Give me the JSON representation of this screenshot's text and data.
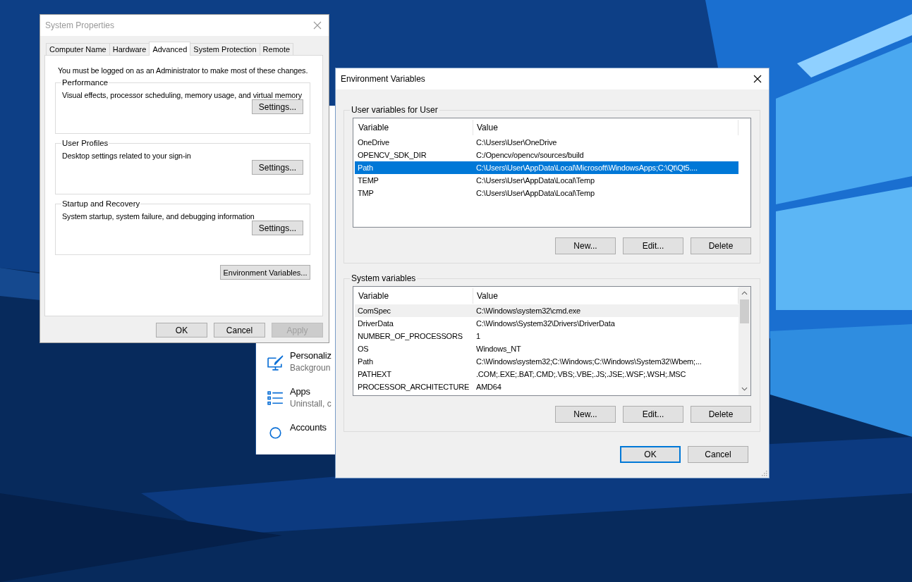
{
  "settings_window": {
    "items": [
      {
        "kind": "personalization",
        "title": "Personaliz",
        "subtitle": "Backgroun"
      },
      {
        "kind": "apps",
        "title": "Apps",
        "subtitle": "Uninstall, c"
      },
      {
        "kind": "accounts",
        "title": "Accounts"
      }
    ]
  },
  "system_properties": {
    "title": "System Properties",
    "active": false,
    "tabs": [
      {
        "label": "Computer Name",
        "selected": false
      },
      {
        "label": "Hardware",
        "selected": false
      },
      {
        "label": "Advanced",
        "selected": true
      },
      {
        "label": "System Protection",
        "selected": false
      },
      {
        "label": "Remote",
        "selected": false
      }
    ],
    "notice": "You must be logged on as an Administrator to make most of these changes.",
    "groups": [
      {
        "label": "Performance",
        "description": "Visual effects, processor scheduling, memory usage, and virtual memory",
        "button": "Settings..."
      },
      {
        "label": "User Profiles",
        "description": "Desktop settings related to your sign-in",
        "button": "Settings..."
      },
      {
        "label": "Startup and Recovery",
        "description": "System startup, system failure, and debugging information",
        "button": "Settings..."
      }
    ],
    "env_button": "Environment Variables...",
    "buttons": [
      {
        "label": "OK",
        "disabled": false
      },
      {
        "label": "Cancel",
        "disabled": false
      },
      {
        "label": "Apply",
        "disabled": true
      }
    ]
  },
  "environment_variables": {
    "title": "Environment Variables",
    "active": true,
    "sections": [
      {
        "label": "User variables for User",
        "focused": true,
        "scrollable": false,
        "columns": [
          "Variable",
          "Value"
        ],
        "rows": [
          {
            "variable": "OneDrive",
            "value": "C:\\Users\\User\\OneDrive",
            "selected": false
          },
          {
            "variable": "OPENCV_SDK_DIR",
            "value": "C:/Opencv/opencv/sources/build",
            "selected": false
          },
          {
            "variable": "Path",
            "value": "C:\\Users\\User\\AppData\\Local\\Microsoft\\WindowsApps;C:\\Qt\\Qt5....",
            "selected": true
          },
          {
            "variable": "TEMP",
            "value": "C:\\Users\\User\\AppData\\Local\\Temp",
            "selected": false
          },
          {
            "variable": "TMP",
            "value": "C:\\Users\\User\\AppData\\Local\\Temp",
            "selected": false
          }
        ],
        "buttons": [
          "New...",
          "Edit...",
          "Delete"
        ]
      },
      {
        "label": "System variables",
        "focused": false,
        "scrollable": true,
        "columns": [
          "Variable",
          "Value"
        ],
        "rows": [
          {
            "variable": "ComSpec",
            "value": "C:\\Windows\\system32\\cmd.exe",
            "selected": true
          },
          {
            "variable": "DriverData",
            "value": "C:\\Windows\\System32\\Drivers\\DriverData",
            "selected": false
          },
          {
            "variable": "NUMBER_OF_PROCESSORS",
            "value": "1",
            "selected": false
          },
          {
            "variable": "OS",
            "value": "Windows_NT",
            "selected": false
          },
          {
            "variable": "Path",
            "value": "C:\\Windows\\system32;C:\\Windows;C:\\Windows\\System32\\Wbem;...",
            "selected": false
          },
          {
            "variable": "PATHEXT",
            "value": ".COM;.EXE;.BAT;.CMD;.VBS;.VBE;.JS;.JSE;.WSF;.WSH;.MSC",
            "selected": false
          },
          {
            "variable": "PROCESSOR_ARCHITECTURE",
            "value": "AMD64",
            "selected": false
          }
        ],
        "buttons": [
          "New...",
          "Edit...",
          "Delete"
        ]
      }
    ],
    "buttons": [
      {
        "label": "OK",
        "default": true
      },
      {
        "label": "Cancel",
        "default": false
      }
    ]
  }
}
